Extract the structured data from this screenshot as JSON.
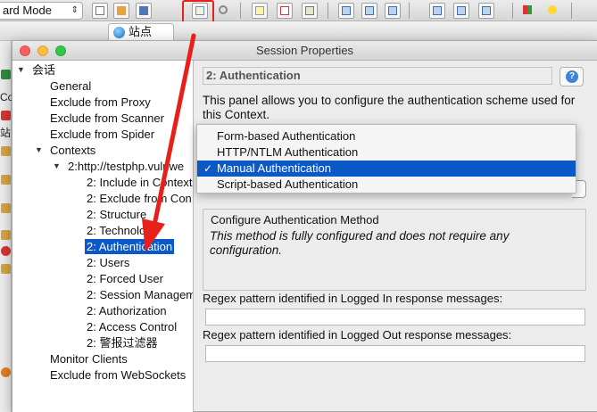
{
  "main_window": {
    "mode_selector": {
      "value": "ard Mode"
    },
    "toolbar_icons": [
      "new-session-icon",
      "open-session-icon",
      "save-session-icon",
      "session-properties-icon",
      "options-gear-icon",
      "breakpoint-icon",
      "breakpoint-off-icon",
      "scan-policy-icon",
      "layout-full-icon",
      "layout-split-icon",
      "layout-tabs-icon",
      "layout-left-icon",
      "layout-right-icon",
      "layout-wide-icon",
      "addons-icon",
      "hint-bulb-icon"
    ],
    "sites_tab": {
      "label": "站点"
    },
    "left_strip_text": [
      "Co",
      "站"
    ]
  },
  "dialog": {
    "title": "Session Properties",
    "tree": {
      "root": "会话",
      "items": [
        {
          "label": "General",
          "indent": 1
        },
        {
          "label": "Exclude from Proxy",
          "indent": 1
        },
        {
          "label": "Exclude from Scanner",
          "indent": 1
        },
        {
          "label": "Exclude from Spider",
          "indent": 1
        },
        {
          "label": "Contexts",
          "indent": 1,
          "expanded": true
        },
        {
          "label": "2:http://testphp.vulnwe",
          "indent": 2,
          "expanded": true
        },
        {
          "label": "2: Include in Context",
          "indent": 3
        },
        {
          "label": "2: Exclude from Con",
          "indent": 3
        },
        {
          "label": "2: Structure",
          "indent": 3
        },
        {
          "label": "2: Technology",
          "indent": 3
        },
        {
          "label": "2: Authentication",
          "indent": 3,
          "selected": true
        },
        {
          "label": "2: Users",
          "indent": 3
        },
        {
          "label": "2: Forced User",
          "indent": 3
        },
        {
          "label": "2: Session Managem",
          "indent": 3
        },
        {
          "label": "2: Authorization",
          "indent": 3
        },
        {
          "label": "2: Access Control",
          "indent": 3
        },
        {
          "label": "2: 警报过滤器",
          "indent": 3
        },
        {
          "label": "Monitor Clients",
          "indent": 1
        },
        {
          "label": "Exclude from WebSockets",
          "indent": 1
        }
      ]
    },
    "panel": {
      "title": "2: Authentication",
      "description": "This panel allows you to configure the authentication scheme used for this Context.",
      "method_dropdown": {
        "options": [
          "Form-based Authentication",
          "HTTP/NTLM Authentication",
          "Manual Authentication",
          "Script-based Authentication"
        ],
        "selected": "Manual Authentication",
        "checkmark": "✓"
      },
      "configure_group": {
        "title": "Configure Authentication Method",
        "note": "This method is fully configured and does not require any configuration."
      },
      "logged_in_regex": {
        "label": "Regex pattern identified in Logged In response messages:",
        "value": ""
      },
      "logged_out_regex": {
        "label": "Regex pattern identified in Logged Out response messages:",
        "value": ""
      }
    }
  },
  "annotation_color": "#e8201c"
}
